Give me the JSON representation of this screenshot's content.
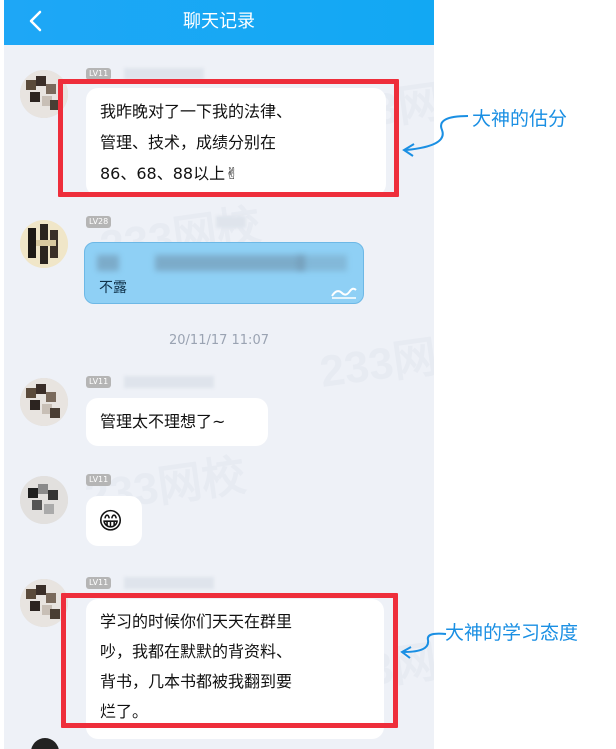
{
  "header": {
    "title": "聊天记录"
  },
  "messages": [
    {
      "level": "LV11",
      "text_lines": [
        "我昨晚对了一下我的法律、",
        "管理、技术，成绩分别在",
        "86、68、88以上✌"
      ]
    },
    {
      "level": "LV28",
      "text": "不露"
    },
    {
      "timestamp": "20/11/17 11:07"
    },
    {
      "level": "LV11",
      "text": "管理太不理想了~"
    },
    {
      "level": "LV11",
      "emoji": "😁"
    },
    {
      "level": "LV11",
      "text_lines": [
        "学习的时候你们天天在群里",
        "吵，我都在默默的背资料、",
        "背书，几本书都被我翻到要",
        "烂了。"
      ]
    }
  ],
  "annotations": [
    {
      "label": "大神的估分"
    },
    {
      "label": "大神的学习态度"
    }
  ],
  "watermark": {
    "text": "233网校"
  },
  "colors": {
    "header": "#1ea7f6",
    "annotation": "#1a8fe3",
    "highlight_box": "#ee2e3b",
    "chat_background": "#eef1f7"
  }
}
